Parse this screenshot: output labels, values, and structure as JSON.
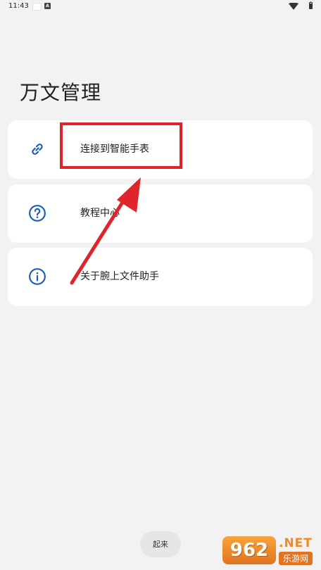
{
  "status_bar": {
    "time": "11:43"
  },
  "app": {
    "title": "万文管理"
  },
  "menu": {
    "items": [
      {
        "label": "连接到智能手表",
        "icon": "link-icon"
      },
      {
        "label": "教程中心",
        "icon": "help-circle-icon"
      },
      {
        "label": "关于腕上文件助手",
        "icon": "info-circle-icon"
      }
    ]
  },
  "bottom": {
    "button_label": "起来"
  },
  "watermark": {
    "badge": "962",
    "suffix": ".NET",
    "site": "乐游网"
  },
  "colors": {
    "accent": "#1a5fb4",
    "annotation": "#e0242b",
    "background": "#f2f2f2"
  }
}
